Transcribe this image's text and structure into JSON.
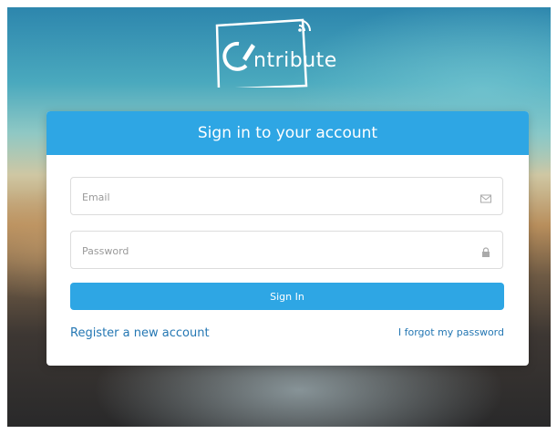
{
  "brand": {
    "name_rest": "ntribute",
    "logo_letters": "Co"
  },
  "card": {
    "title": "Sign in to your account"
  },
  "form": {
    "email_placeholder": "Email",
    "password_placeholder": "Password",
    "submit_label": "Sign In"
  },
  "links": {
    "register": "Register a new account",
    "forgot": "I forgot my password"
  },
  "icons": {
    "email": "envelope-icon",
    "password": "lock-icon",
    "logo_signal": "wifi-signal-icon"
  },
  "colors": {
    "accent": "#2ea6e4",
    "link": "#2477b3"
  }
}
